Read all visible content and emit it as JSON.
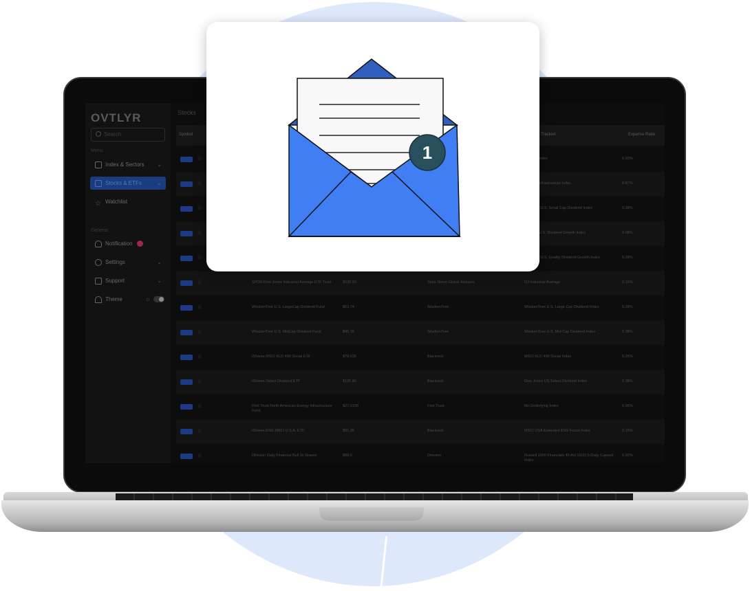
{
  "app": {
    "logo": "OVTLYR",
    "search_placeholder": "Search"
  },
  "sidebar": {
    "section_menu": "Menu",
    "section_general": "General",
    "items": [
      {
        "label": "Index & Sectors"
      },
      {
        "label": "Stocks & ETFs"
      },
      {
        "label": "Watchlist"
      },
      {
        "label": "Notification"
      },
      {
        "label": "Settings"
      },
      {
        "label": "Support"
      },
      {
        "label": "Theme"
      }
    ]
  },
  "main": {
    "title": "Stocks",
    "headers": [
      "Symbol",
      "Tracked",
      "Expense Ratio"
    ],
    "rows": [
      {
        "name": "",
        "price": "",
        "issuer": "",
        "index": "an MLP Index",
        "ratio": "0.93%"
      },
      {
        "name": "",
        "price": "",
        "issuer": "",
        "index": "an MLP Infrastructure Index",
        "ratio": "0.87%"
      },
      {
        "name": "",
        "price": "",
        "issuer": "",
        "index": "domTree U.S. Small Cap Dividend Index",
        "ratio": "0.38%"
      },
      {
        "name": "",
        "price": "",
        "issuer": "",
        "index": "ningstar U.S. Dividend Growth Index",
        "ratio": "0.08%"
      },
      {
        "name": "",
        "price": "",
        "issuer": "",
        "index": "domTree U.S. Quality Dividend Growth Index",
        "ratio": "0.28%"
      },
      {
        "name": "SPDR Dow Jones Industrial Average ETF Trust",
        "price": "$339.59",
        "issuer": "State Street Global Advisors",
        "index": "DJ Industrial Average",
        "ratio": "0.16%"
      },
      {
        "name": "WisdomTree U.S. LargeCap Dividend Fund",
        "price": "$63.74",
        "issuer": "WisdomTree",
        "index": "WisdomTree U.S. Large Cap Dividend Index",
        "ratio": "0.28%"
      },
      {
        "name": "WisdomTree U.S. MidCap Dividend Fund",
        "price": "$45.18",
        "issuer": "WisdomTree",
        "index": "WisdomTree U.S. Mid Cap Dividend Index",
        "ratio": "0.38%"
      },
      {
        "name": "iShares MSCI KLD 400 Social ETF",
        "price": "$78.635",
        "issuer": "Blackrock",
        "index": "MSCI KLD 400 Social Index",
        "ratio": "0.25%"
      },
      {
        "name": "iShares Select Dividend ETF",
        "price": "$125.86",
        "issuer": "Blackrock",
        "index": "Dow Jones US Select Dividend Index",
        "ratio": "0.38%"
      },
      {
        "name": "First Trust North American Energy Infrastructure Fund",
        "price": "$27.0198",
        "issuer": "First Trust",
        "index": "No Underlying Index",
        "ratio": "0.95%"
      },
      {
        "name": "iShares ESG MSCI U.S.A. ETF",
        "price": "$91.36",
        "issuer": "Blackrock",
        "index": "MSCI USA Extended ESG Focus Index",
        "ratio": "0.15%"
      },
      {
        "name": "Direxion Daily Financial Bull 3x Shares",
        "price": "$88.6",
        "issuer": "Direxion",
        "index": "Russell 1000 Financials 40 Act 15/22.5 Daily Capped Index",
        "ratio": "0.92%"
      }
    ]
  },
  "card": {
    "badge_count": "1"
  },
  "colors": {
    "envelope_blue": "#3f7ef3",
    "envelope_flap": "#2f5fbf",
    "badge_bg": "#274f5c",
    "background_circle": "#dde8fb"
  }
}
